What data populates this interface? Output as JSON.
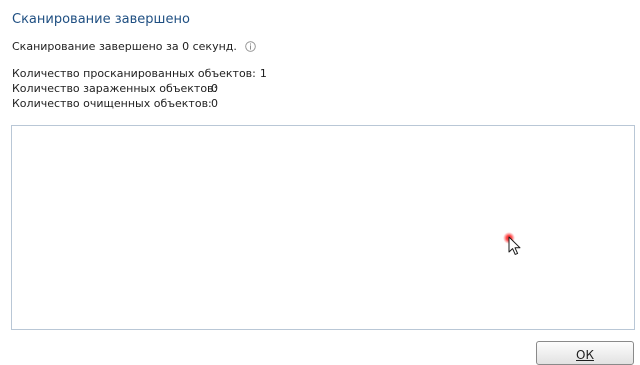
{
  "dialog": {
    "title": "Сканирование завершено",
    "summary": "Сканирование завершено за 0 секунд.",
    "info_icon": "info-circle-icon",
    "accent_color": "#1f4f82"
  },
  "stats": [
    {
      "label": "Количество просканированных объектов:",
      "value": "1"
    },
    {
      "label": "Количество зараженных объектов:",
      "value": "0"
    },
    {
      "label": "Количество очищенных объектов:",
      "value": "0"
    }
  ],
  "results": {
    "items": []
  },
  "buttons": {
    "ok_label": "ОК"
  }
}
